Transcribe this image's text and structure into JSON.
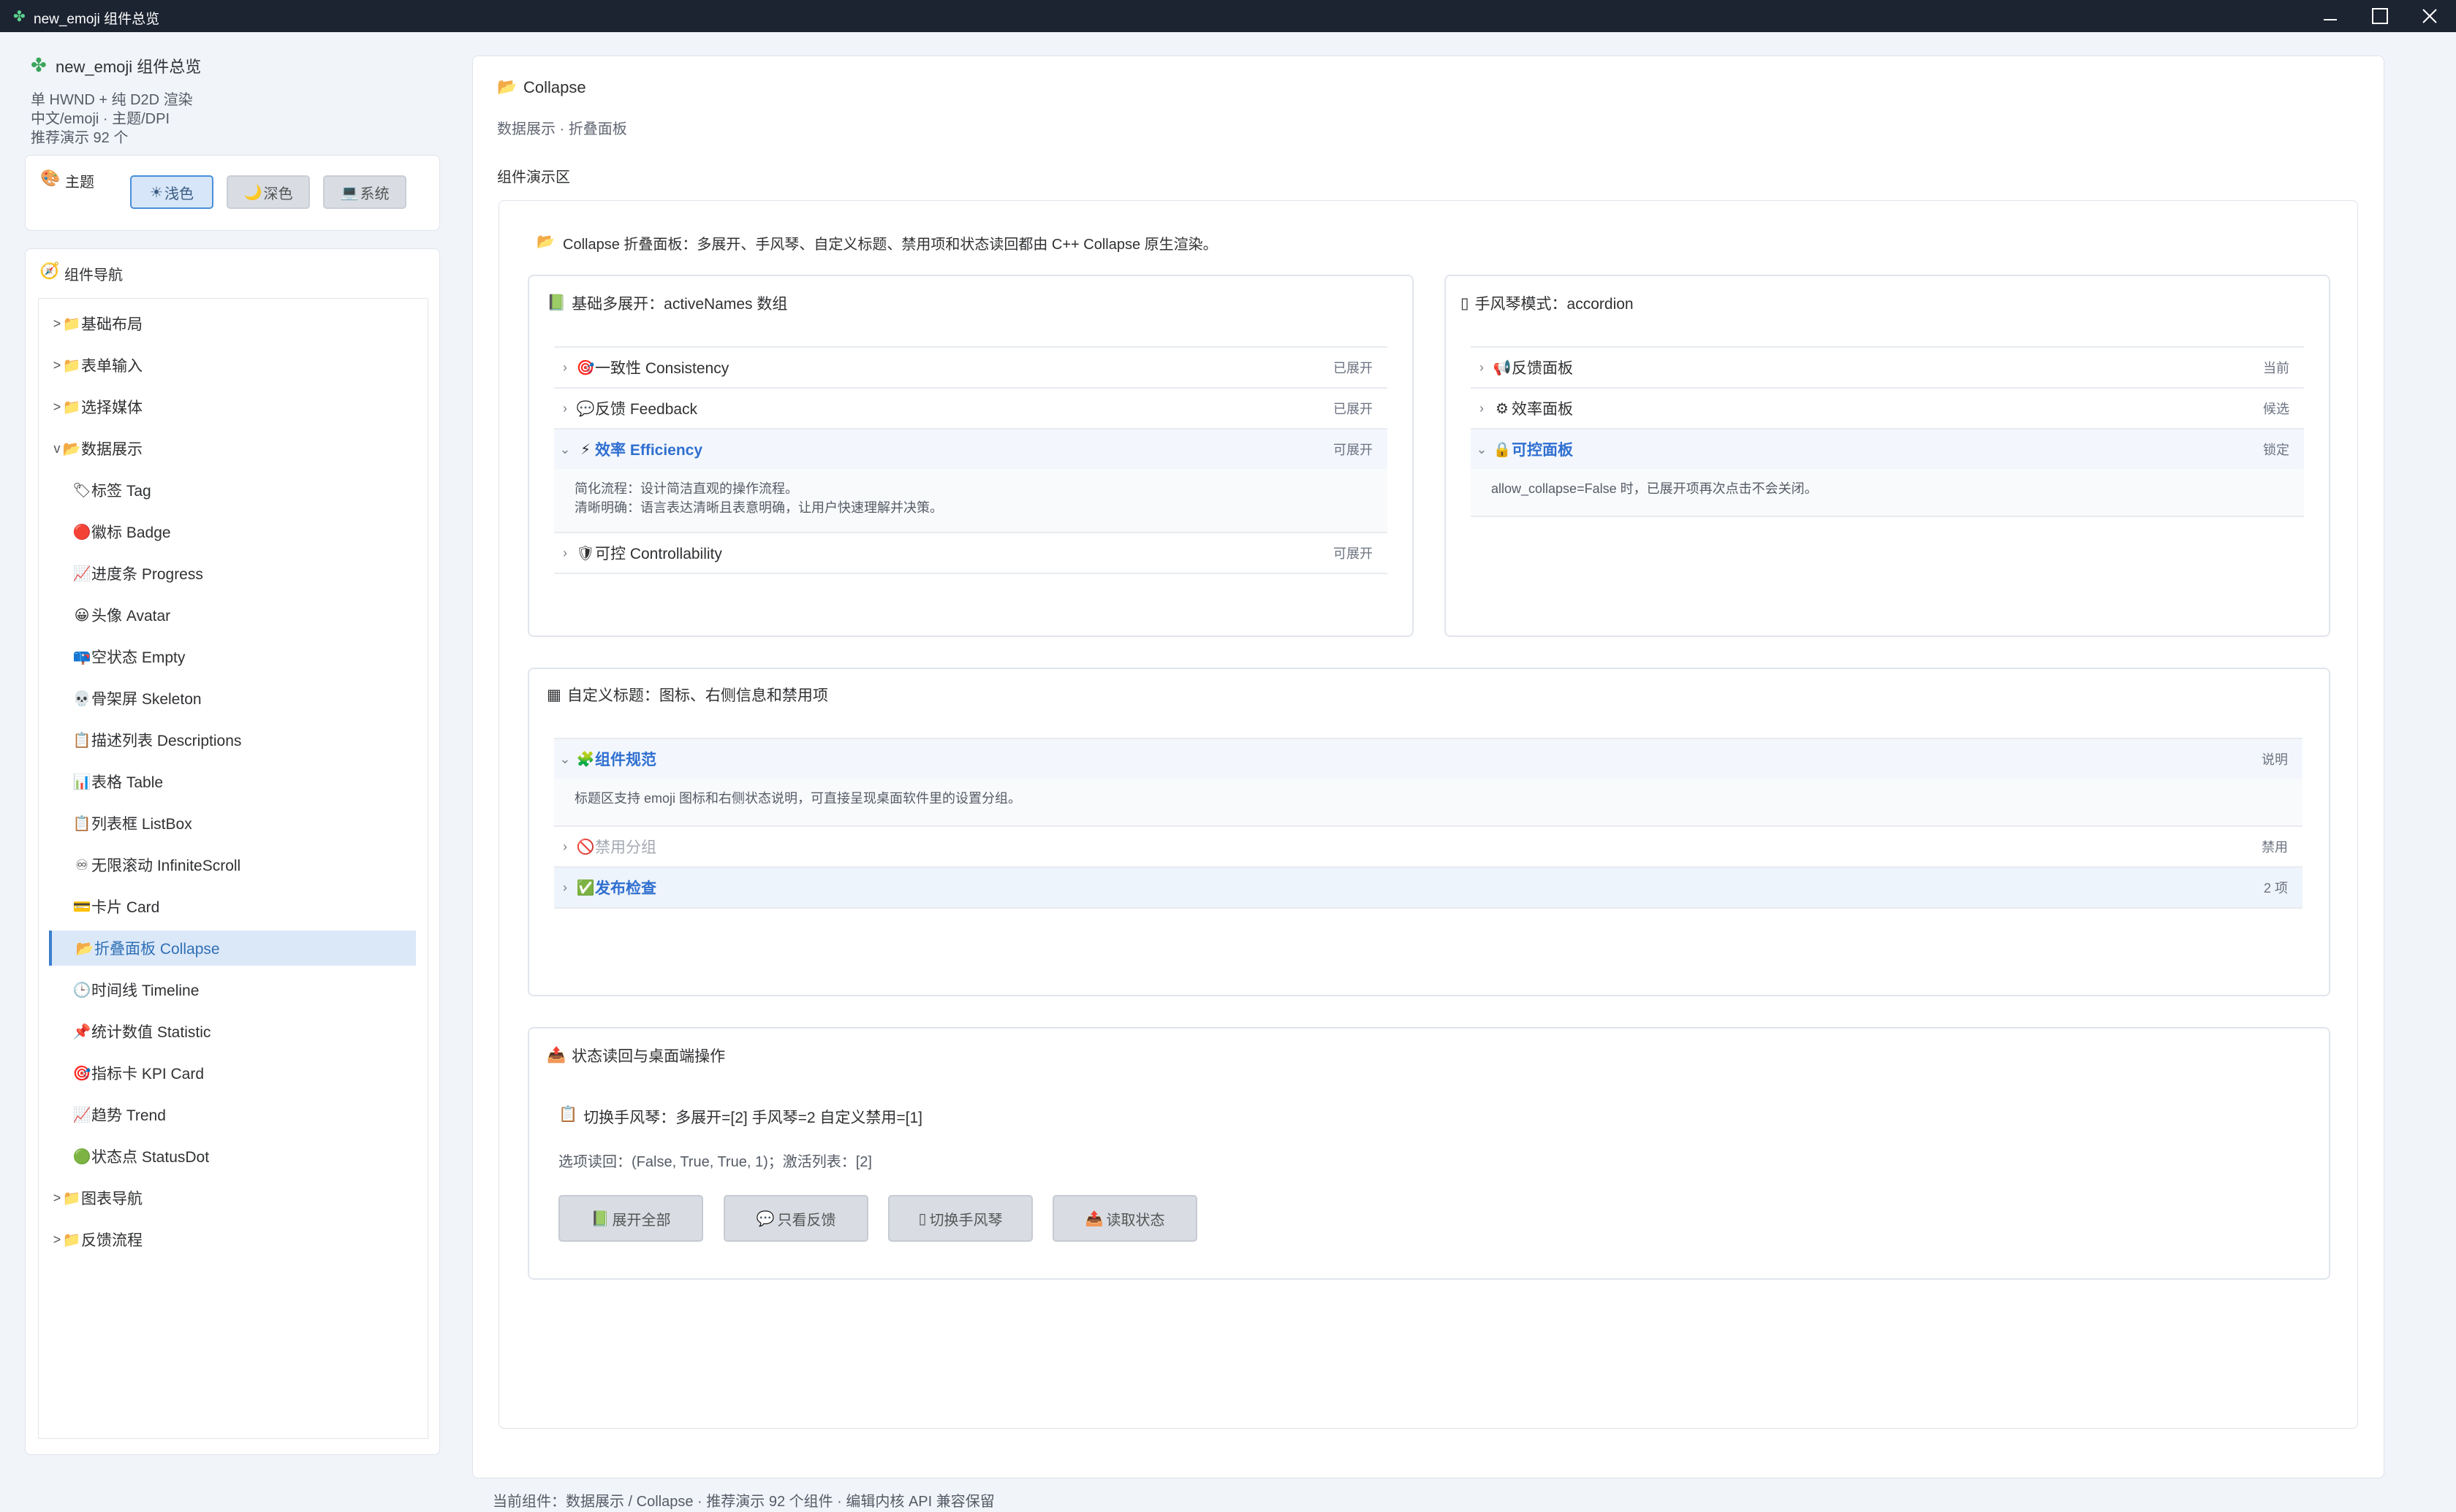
{
  "window": {
    "title": "new_emoji 组件总览",
    "icon": "puzzle-icon",
    "controls": [
      "minimize",
      "maximize",
      "close"
    ]
  },
  "sidebar": {
    "app_name": "new_emoji 组件总览",
    "info_lines": [
      "单 HWND + 纯 D2D 渲染",
      "中文/emoji · 主题/DPI",
      "推荐演示 92 个"
    ],
    "theme": {
      "icon": "palette-icon",
      "label": "主题",
      "options": [
        {
          "icon": "☀",
          "label": "浅色",
          "active": true
        },
        {
          "icon": "🌙",
          "label": "深色",
          "active": false
        },
        {
          "icon": "💻",
          "label": "系统",
          "active": false
        }
      ]
    },
    "nav": {
      "icon": "compass-icon",
      "title": "组件导航",
      "items": [
        {
          "arrow": ">",
          "icon": "📁",
          "label": "基础布局",
          "indent": 0
        },
        {
          "arrow": ">",
          "icon": "📁",
          "label": "表单输入",
          "indent": 0
        },
        {
          "arrow": ">",
          "icon": "📁",
          "label": "选择媒体",
          "indent": 0
        },
        {
          "arrow": "v",
          "icon": "📂",
          "label": "数据展示",
          "indent": 0
        },
        {
          "arrow": "",
          "icon": "🏷",
          "label": "标签 Tag",
          "indent": 1
        },
        {
          "arrow": "",
          "icon": "🔴",
          "label": "徽标 Badge",
          "indent": 1
        },
        {
          "arrow": "",
          "icon": "📈",
          "label": "进度条 Progress",
          "indent": 1
        },
        {
          "arrow": "",
          "icon": "😀",
          "label": "头像 Avatar",
          "indent": 1
        },
        {
          "arrow": "",
          "icon": "📪",
          "label": "空状态 Empty",
          "indent": 1
        },
        {
          "arrow": "",
          "icon": "💀",
          "label": "骨架屏 Skeleton",
          "indent": 1
        },
        {
          "arrow": "",
          "icon": "📋",
          "label": "描述列表 Descriptions",
          "indent": 1
        },
        {
          "arrow": "",
          "icon": "📊",
          "label": "表格 Table",
          "indent": 1
        },
        {
          "arrow": "",
          "icon": "📋",
          "label": "列表框 ListBox",
          "indent": 1
        },
        {
          "arrow": "",
          "icon": "♾",
          "label": "无限滚动 InfiniteScroll",
          "indent": 1
        },
        {
          "arrow": "",
          "icon": "💳",
          "label": "卡片 Card",
          "indent": 1
        },
        {
          "arrow": "",
          "icon": "📂",
          "label": "折叠面板 Collapse",
          "indent": 1,
          "active": true
        },
        {
          "arrow": "",
          "icon": "🕒",
          "label": "时间线 Timeline",
          "indent": 1
        },
        {
          "arrow": "",
          "icon": "📌",
          "label": "统计数值 Statistic",
          "indent": 1
        },
        {
          "arrow": "",
          "icon": "🎯",
          "label": "指标卡 KPI Card",
          "indent": 1
        },
        {
          "arrow": "",
          "icon": "📈",
          "label": "趋势 Trend",
          "indent": 1
        },
        {
          "arrow": "",
          "icon": "🟢",
          "label": "状态点 StatusDot",
          "indent": 1
        },
        {
          "arrow": ">",
          "icon": "📁",
          "label": "图表导航",
          "indent": 0
        },
        {
          "arrow": ">",
          "icon": "📁",
          "label": "反馈流程",
          "indent": 0
        }
      ]
    }
  },
  "main": {
    "header_icon": "📂",
    "title": "Collapse",
    "subtitle": "数据展示 · 折叠面板",
    "demo_label": "组件演示区",
    "intro_icon": "📂",
    "intro": "Collapse 折叠面板：多展开、手风琴、自定义标题、禁用项和状态读回都由 C++ Collapse 原生渲染。",
    "basic": {
      "icon": "📗",
      "title": "基础多展开：activeNames 数组",
      "items": [
        {
          "icon": "🎯",
          "title": "一致性 Consistency",
          "right": "已展开",
          "expanded": false
        },
        {
          "icon": "💬",
          "title": "反馈 Feedback",
          "right": "已展开",
          "expanded": false
        },
        {
          "icon": "⚡",
          "title": "效率 Efficiency",
          "right": "可展开",
          "expanded": true,
          "content": [
            "简化流程：设计简洁直观的操作流程。",
            "清晰明确：语言表达清晰且表意明确，让用户快速理解并决策。"
          ]
        },
        {
          "icon": "🛡",
          "title": "可控 Controllability",
          "right": "可展开",
          "expanded": false
        }
      ]
    },
    "accordion": {
      "icon": "▯",
      "title": "手风琴模式：accordion",
      "items": [
        {
          "icon": "📢",
          "title": "反馈面板",
          "right": "当前",
          "expanded": false
        },
        {
          "icon": "⚙",
          "title": "效率面板",
          "right": "候选",
          "expanded": false
        },
        {
          "icon": "🔒",
          "title": "可控面板",
          "right": "锁定",
          "expanded": true,
          "content": [
            "allow_collapse=False 时，已展开项再次点击不会关闭。"
          ]
        }
      ]
    },
    "custom": {
      "icon": "▦",
      "title": "自定义标题：图标、右侧信息和禁用项",
      "items": [
        {
          "icon": "🧩",
          "title": "组件规范",
          "right": "说明",
          "expanded": true,
          "disabled": false,
          "content": [
            "标题区支持 emoji 图标和右侧状态说明，可直接呈现桌面软件里的设置分组。"
          ]
        },
        {
          "icon": "🚫",
          "title": "禁用分组",
          "right": "禁用",
          "expanded": false,
          "disabled": true
        },
        {
          "icon": "✅",
          "title": "发布检查",
          "right": "2 项",
          "expanded": false,
          "disabled": false,
          "hover": true
        }
      ]
    },
    "state": {
      "icon": "📤",
      "title": "状态读回与桌面端操作",
      "line1_icon": "📋",
      "line1": "切换手风琴：多展开=[2] 手风琴=2 自定义禁用=[1]",
      "line2": "选项读回：(False, True, True, 1)；激活列表：[2]",
      "buttons": [
        {
          "icon": "📗",
          "label": "展开全部"
        },
        {
          "icon": "💬",
          "label": "只看反馈"
        },
        {
          "icon": "▯",
          "label": "切换手风琴"
        },
        {
          "icon": "📤",
          "label": "读取状态"
        }
      ]
    }
  },
  "status_bar": "当前组件：数据展示 / Collapse · 推荐演示 92 个组件 · 编辑内核 API 兼容保留"
}
